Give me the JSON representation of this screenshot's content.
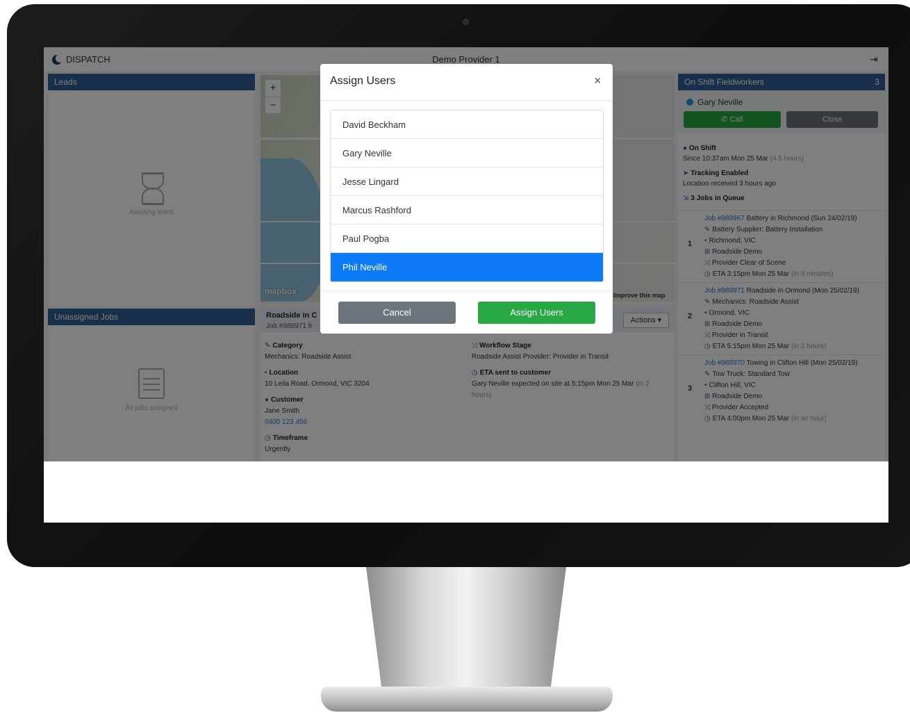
{
  "app": {
    "brand": "DISPATCH",
    "provider": "Demo Provider 1"
  },
  "leads": {
    "title": "Leads",
    "empty_text": "Awaiting leads"
  },
  "unassigned": {
    "title": "Unassigned Jobs",
    "empty_text": "All jobs assigned"
  },
  "map": {
    "zoom_in": "+",
    "zoom_out": "−",
    "logo": "mapbox",
    "improve": "Improve this map"
  },
  "job": {
    "title": "Roadside in C",
    "subtitle": "Job #988971 fr",
    "actions_label": "Actions ▾",
    "category_label": "Category",
    "category_value": "Mechanics: Roadside Assist",
    "location_label": "Location",
    "location_value": "10 Leila Road, Ormond, VIC 3204",
    "customer_label": "Customer",
    "customer_name": "Jane Smith",
    "customer_phone": "0400 123 456",
    "timeframe_label": "Timeframe",
    "timeframe_value": "Urgently",
    "workflow_label": "Workflow Stage",
    "workflow_value": "Roadside Assist Provider: Provider in Transit",
    "eta_label": "ETA sent to customer",
    "eta_value": "Gary Neville expected on site at 5:15pm Mon 25 Mar",
    "eta_muted": "(in 2 hours)"
  },
  "fieldworkers": {
    "title": "On Shift Fieldworkers",
    "count": "3",
    "name": "Gary Neville",
    "call_label": "Call",
    "close_label": "Close",
    "shift_label": "On Shift",
    "shift_since": "Since 10:37am Mon 25 Mar",
    "shift_hours": "(4.5 hours)",
    "tracking_label": "Tracking Enabled",
    "tracking_value": "Location received 3 hours ago",
    "queue_label": "3 Jobs in Queue",
    "queue": [
      {
        "num": "1",
        "job_no": "Job #988967",
        "job_title": "Battery in Richmond (Sun 24/02/19)",
        "category": "Battery Supplier: Battery Installation",
        "location": "Richmond, VIC",
        "org": "Roadside Demo",
        "stage": "Provider Clear of Scene",
        "eta": "ETA 3:15pm Mon 25 Mar",
        "eta_rel": "(in 9 minutes)"
      },
      {
        "num": "2",
        "job_no": "Job #988971",
        "job_title": "Roadside in Ormond (Mon 25/02/19)",
        "category": "Mechanics: Roadside Assist",
        "location": "Ormond, VIC",
        "org": "Roadside Demo",
        "stage": "Provider in Transit",
        "eta": "ETA 5:15pm Mon 25 Mar",
        "eta_rel": "(in 2 hours)"
      },
      {
        "num": "3",
        "job_no": "Job #988970",
        "job_title": "Towing in Clifton Hill (Mon 25/02/19)",
        "category": "Tow Truck: Standard Tow",
        "location": "Clifton Hill, VIC",
        "org": "Roadside Demo",
        "stage": "Provider Accepted",
        "eta": "ETA 4:00pm Mon 25 Mar",
        "eta_rel": "(in an hour)"
      }
    ]
  },
  "modal": {
    "title": "Assign Users",
    "close": "×",
    "users": [
      "David Beckham",
      "Gary Neville",
      "Jesse Lingard",
      "Marcus Rashford",
      "Paul Pogba",
      "Phil Neville"
    ],
    "selected_user": "Phil Neville",
    "cancel_label": "Cancel",
    "assign_label": "Assign Users"
  },
  "colors": {
    "primary": "#0d7bf5",
    "success": "#28a745",
    "secondary": "#6c757d",
    "panel_header": "#2f5f97"
  }
}
